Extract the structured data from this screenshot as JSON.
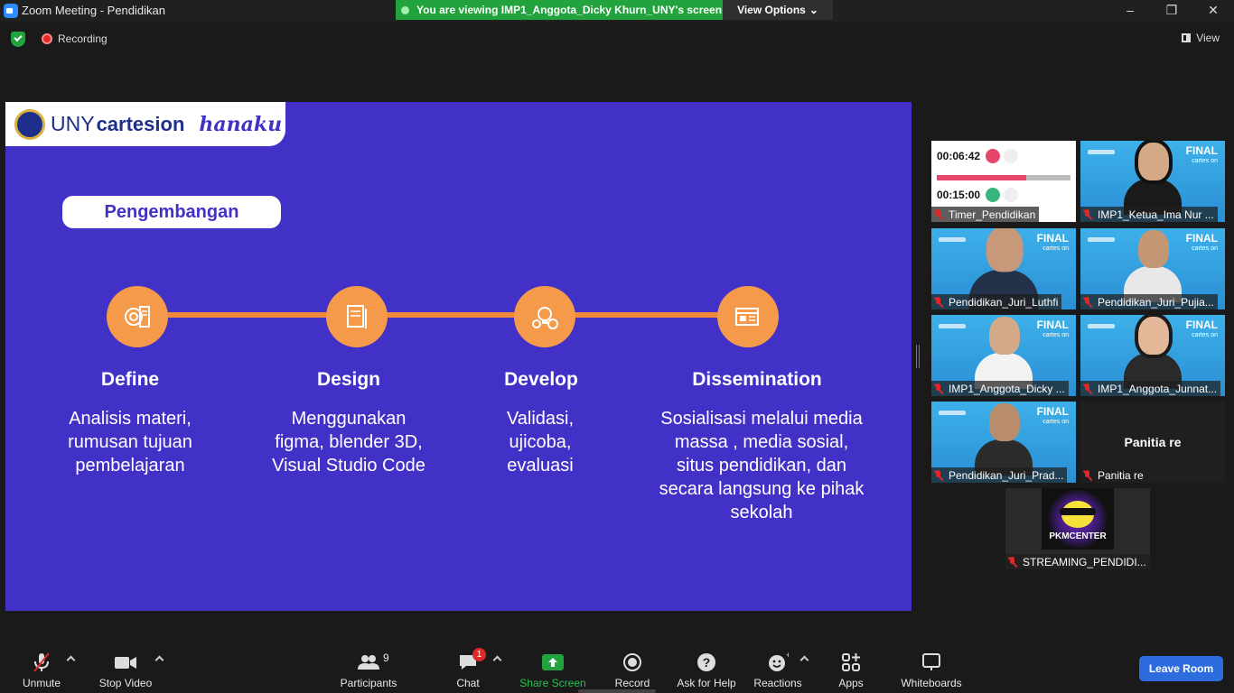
{
  "window": {
    "title": "Zoom Meeting - Pendidikan",
    "banner": "You are viewing IMP1_Anggota_Dicky Khurn_UNY's screen",
    "view_options": "View Options",
    "recording": "Recording",
    "view": "View"
  },
  "slide": {
    "brand_uny": "UNY",
    "brand_cartesion": "cartesion",
    "brand_hanaku": "hanaku",
    "heading": "Pengembangan",
    "steps": [
      {
        "title": "Define",
        "desc": "Analisis materi, rumusan tujuan pembelajaran"
      },
      {
        "title": "Design",
        "desc": "Menggunakan figma, blender 3D, Visual Studio Code"
      },
      {
        "title": "Develop",
        "desc": "Validasi, ujicoba, evaluasi"
      },
      {
        "title": "Dissemination",
        "desc": "Sosialisasi melalui media massa , media sosial, situs pendidikan, dan secara langsung ke pihak sekolah"
      }
    ]
  },
  "gallery": {
    "timer": {
      "time1": "00:06:42",
      "time2": "00:15:00",
      "progress": 0.67,
      "name": "Timer_Pendidikan"
    },
    "participants": [
      {
        "name": "IMP1_Ketua_Ima Nur ..."
      },
      {
        "name": "Pendidikan_Juri_Luthfi"
      },
      {
        "name": "Pendidikan_Juri_Pujia..."
      },
      {
        "name": "IMP1_Anggota_Dicky ..."
      },
      {
        "name": "IMP1_Anggota_Junnat..."
      },
      {
        "name": "Pendidikan_Juri_Prad..."
      },
      {
        "name": "Panitia re",
        "big": "Panitia re"
      },
      {
        "name": "STREAMING_PENDIDI...",
        "logo": "PKMCENTER"
      }
    ],
    "final_label": "FINAL",
    "final_sub": "cartes on"
  },
  "toolbar": {
    "unmute": "Unmute",
    "stop_video": "Stop Video",
    "participants": "Participants",
    "participants_count": "9",
    "chat": "Chat",
    "chat_badge": "1",
    "share_screen": "Share Screen",
    "record": "Record",
    "ask_help": "Ask for Help",
    "reactions": "Reactions",
    "apps": "Apps",
    "whiteboards": "Whiteboards",
    "leave": "Leave Room"
  },
  "colors": {
    "slide_bg": "#4231c7",
    "accent_orange": "#f49a4a",
    "banner_green": "#23a33d",
    "leave_blue": "#2d6cdf"
  }
}
